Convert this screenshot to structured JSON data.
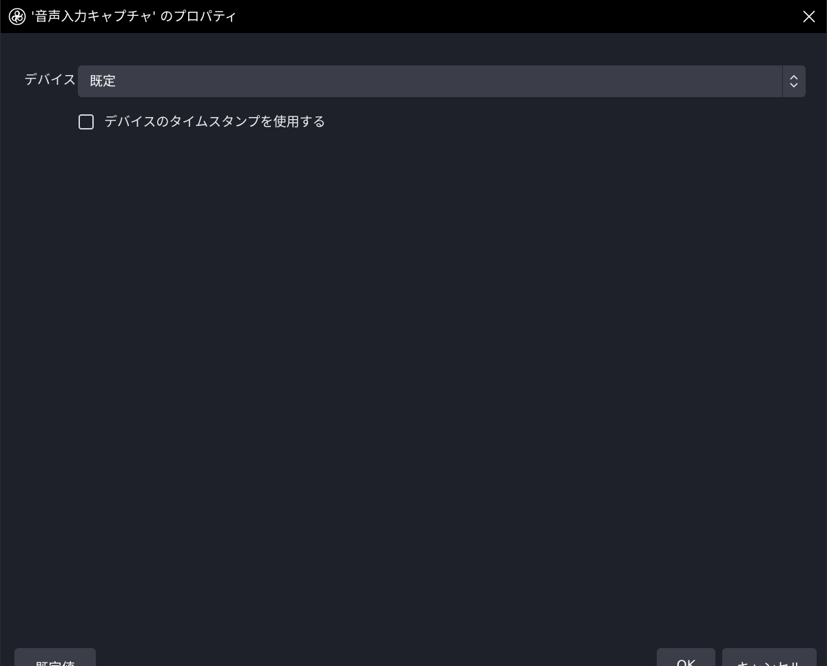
{
  "window": {
    "title": "'音声入力キャプチャ' のプロパティ",
    "app_icon": "obs-logo-icon",
    "close_icon": "close-icon"
  },
  "form": {
    "device_label": "デバイス",
    "device_value": "既定",
    "device_arrows_icon": "chevron-up-down-icon",
    "timestamp_checkbox_label": "デバイスのタイムスタンプを使用する",
    "timestamp_checked": false
  },
  "buttons": {
    "defaults": "既定値",
    "ok": "OK",
    "cancel": "キャンセル"
  },
  "colors": {
    "background": "#1f212a",
    "titlebar": "#000000",
    "control": "#3b3e49",
    "text": "#ffffff"
  }
}
